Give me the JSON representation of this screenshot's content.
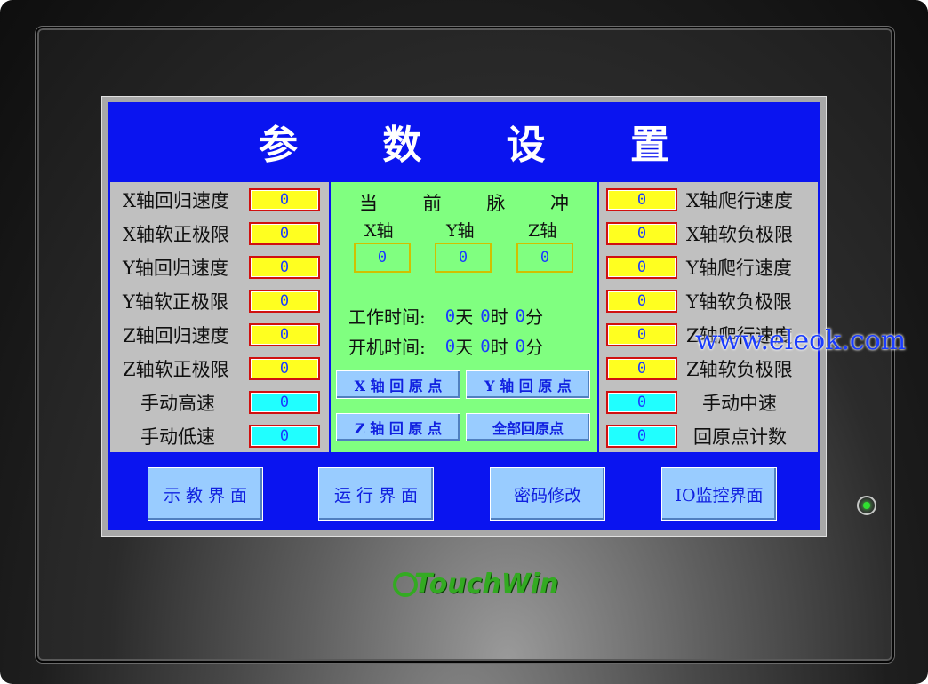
{
  "title": "参 数 设 置",
  "left_params": [
    {
      "label": "X轴回归速度",
      "value": "0",
      "color": "yellow"
    },
    {
      "label": "X轴软正极限",
      "value": "0",
      "color": "yellow"
    },
    {
      "label": "Y轴回归速度",
      "value": "0",
      "color": "yellow"
    },
    {
      "label": "Y轴软正极限",
      "value": "0",
      "color": "yellow"
    },
    {
      "label": "Z轴回归速度",
      "value": "0",
      "color": "yellow"
    },
    {
      "label": "Z轴软正极限",
      "value": "0",
      "color": "yellow"
    },
    {
      "label": "手动高速",
      "value": "0",
      "color": "cyan"
    },
    {
      "label": "手动低速",
      "value": "0",
      "color": "cyan"
    }
  ],
  "right_params": [
    {
      "label": "X轴爬行速度",
      "value": "0",
      "color": "yellow"
    },
    {
      "label": "X轴软负极限",
      "value": "0",
      "color": "yellow"
    },
    {
      "label": "Y轴爬行速度",
      "value": "0",
      "color": "yellow"
    },
    {
      "label": "Y轴软负极限",
      "value": "0",
      "color": "yellow"
    },
    {
      "label": "Z轴爬行速度",
      "value": "0",
      "color": "yellow"
    },
    {
      "label": "Z轴软负极限",
      "value": "0",
      "color": "yellow"
    },
    {
      "label": "手动中速",
      "value": "0",
      "color": "cyan"
    },
    {
      "label": "回原点计数",
      "value": "0",
      "color": "cyan"
    }
  ],
  "pulse": {
    "title": "当 前 脉 冲",
    "axes": [
      {
        "label": "X轴",
        "value": "0"
      },
      {
        "label": "Y轴",
        "value": "0"
      },
      {
        "label": "Z轴",
        "value": "0"
      }
    ]
  },
  "work_time": {
    "label": "工作时间:",
    "days": "0",
    "day_unit": "天",
    "hours": "0",
    "hour_unit": "时",
    "minutes": "0",
    "minute_unit": "分"
  },
  "boot_time": {
    "label": "开机时间:",
    "days": "0",
    "day_unit": "天",
    "hours": "0",
    "hour_unit": "时",
    "minutes": "0",
    "minute_unit": "分"
  },
  "home_buttons": {
    "x": "X 轴 回 原 点",
    "y": "Y 轴 回 原 点",
    "z": "Z 轴 回 原 点",
    "all": "全部回原点"
  },
  "nav_buttons": {
    "teach": "示 教 界 面",
    "run": "运 行 界 面",
    "password": "密码修改",
    "io": "IO监控界面"
  },
  "watermark": "www.eleok.com",
  "brand": "TouchWin",
  "colors": {
    "screen_bg": "#0a14f0",
    "param_bg": "#c0c0c0",
    "pulse_bg": "#80ff80",
    "yellow_field": "#ffff20",
    "cyan_field": "#20ffff",
    "button_bg": "#99ccff",
    "brand_green": "#33aa22"
  }
}
